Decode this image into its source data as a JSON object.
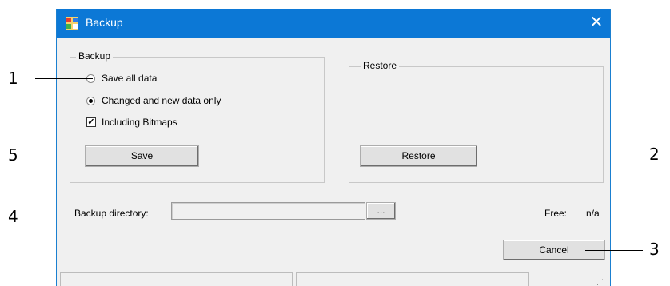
{
  "window": {
    "title": "Backup",
    "close_glyph": "✕"
  },
  "backup_group": {
    "legend": "Backup",
    "options": [
      {
        "label": "Save all data",
        "selected": false
      },
      {
        "label": "Changed and new data only",
        "selected": true
      }
    ],
    "include_bitmaps": {
      "label": "Including Bitmaps",
      "checked": true
    },
    "save_button": "Save"
  },
  "restore_group": {
    "legend": "Restore",
    "restore_button": "Restore"
  },
  "directory": {
    "label": "Backup directory:",
    "value": "",
    "browse_button": "..."
  },
  "free": {
    "label": "Free:",
    "value": "n/a"
  },
  "cancel_button": "Cancel",
  "callouts": [
    "1",
    "2",
    "3",
    "4",
    "5"
  ],
  "colors": {
    "titlebar": "#0c78d6",
    "window_bg": "#f0f0f0"
  },
  "icons": {
    "app_icon": "backup-app-icon",
    "close_icon": "close-icon"
  }
}
